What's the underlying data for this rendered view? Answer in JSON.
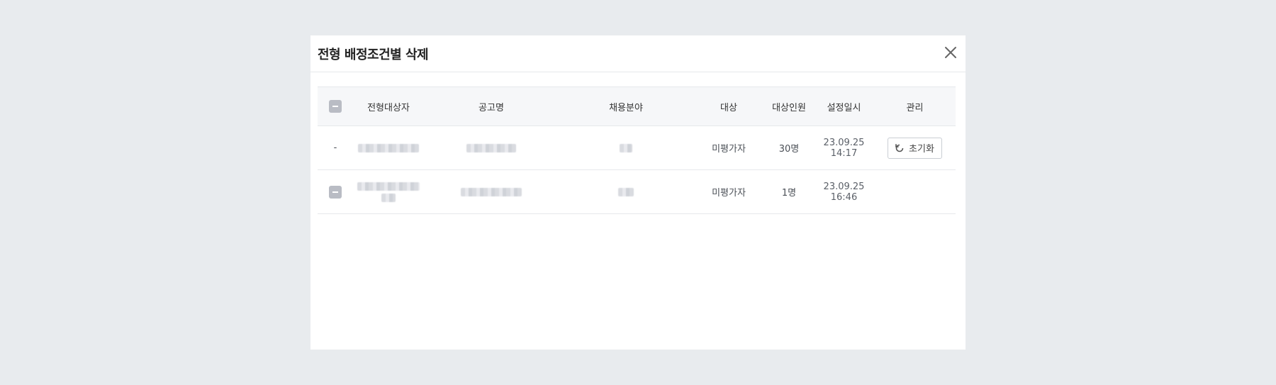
{
  "modal": {
    "title": "전형 배정조건별 삭제"
  },
  "table": {
    "headers": {
      "applicant": "전형대상자",
      "posting": "공고명",
      "field": "채용분야",
      "target": "대상",
      "count": "대상인원",
      "date": "설정일시",
      "manage": "관리"
    },
    "rows": [
      {
        "checkbox": "-",
        "target": "미평가자",
        "count": "30명",
        "date_line1": "23.09.25",
        "date_line2": "14:17",
        "action_label": "초기화"
      },
      {
        "target": "미평가자",
        "count": "1명",
        "date_line1": "23.09.25",
        "date_line2": "16:46"
      }
    ]
  },
  "icons": {
    "close": "close-icon",
    "reset": "refresh-icon"
  },
  "colors": {
    "overlay_bg": "#e8ebee",
    "header_bg": "#f6f7f9",
    "checkbox": "#b9bcc4"
  }
}
